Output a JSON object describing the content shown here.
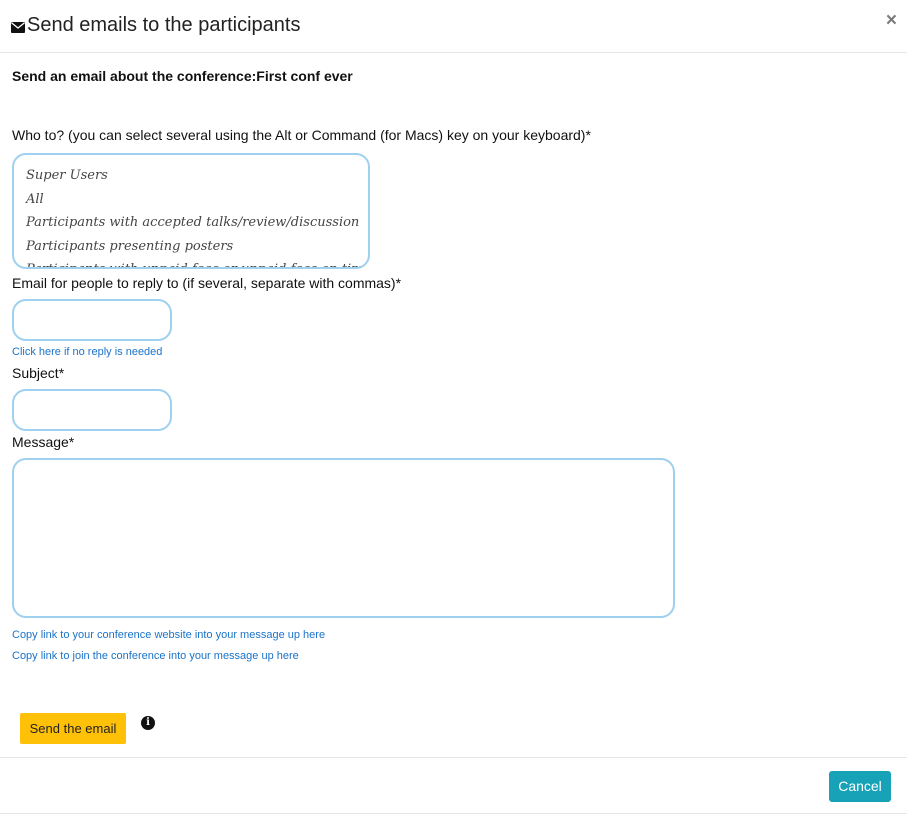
{
  "header": {
    "title": "Send emails to the participants",
    "title_icon": "envelope-icon",
    "close_label": "×"
  },
  "form": {
    "heading": "Send an email about the conference:First conf ever",
    "recipients": {
      "label": "Who to? (you can select several using the Alt or Command (for Macs) key on your keyboard)*",
      "options": [
        "Super Users",
        "All",
        "Participants with accepted talks/review/discussion",
        "Participants presenting posters",
        "Participants with unpaid fees or unpaid fees on time of"
      ]
    },
    "reply_to": {
      "label": "Email for people to reply to (if several, separate with commas)*",
      "value": "",
      "no_reply_link": "Click here if no reply is needed"
    },
    "subject": {
      "label": "Subject*",
      "value": ""
    },
    "message": {
      "label": "Message*",
      "value": "",
      "copy_website_link": "Copy link to your conference website into your message up here",
      "copy_join_link": "Copy link to join the conference into your message up here"
    },
    "send_label": "Send the email",
    "info_icon": "info-icon",
    "info_glyph": "i"
  },
  "footer": {
    "cancel_label": "Cancel"
  },
  "colors": {
    "input_border": "#9fd0ef",
    "link": "#1a73c8",
    "send_button": "#ffc107",
    "cancel_button": "#17a2b8"
  }
}
